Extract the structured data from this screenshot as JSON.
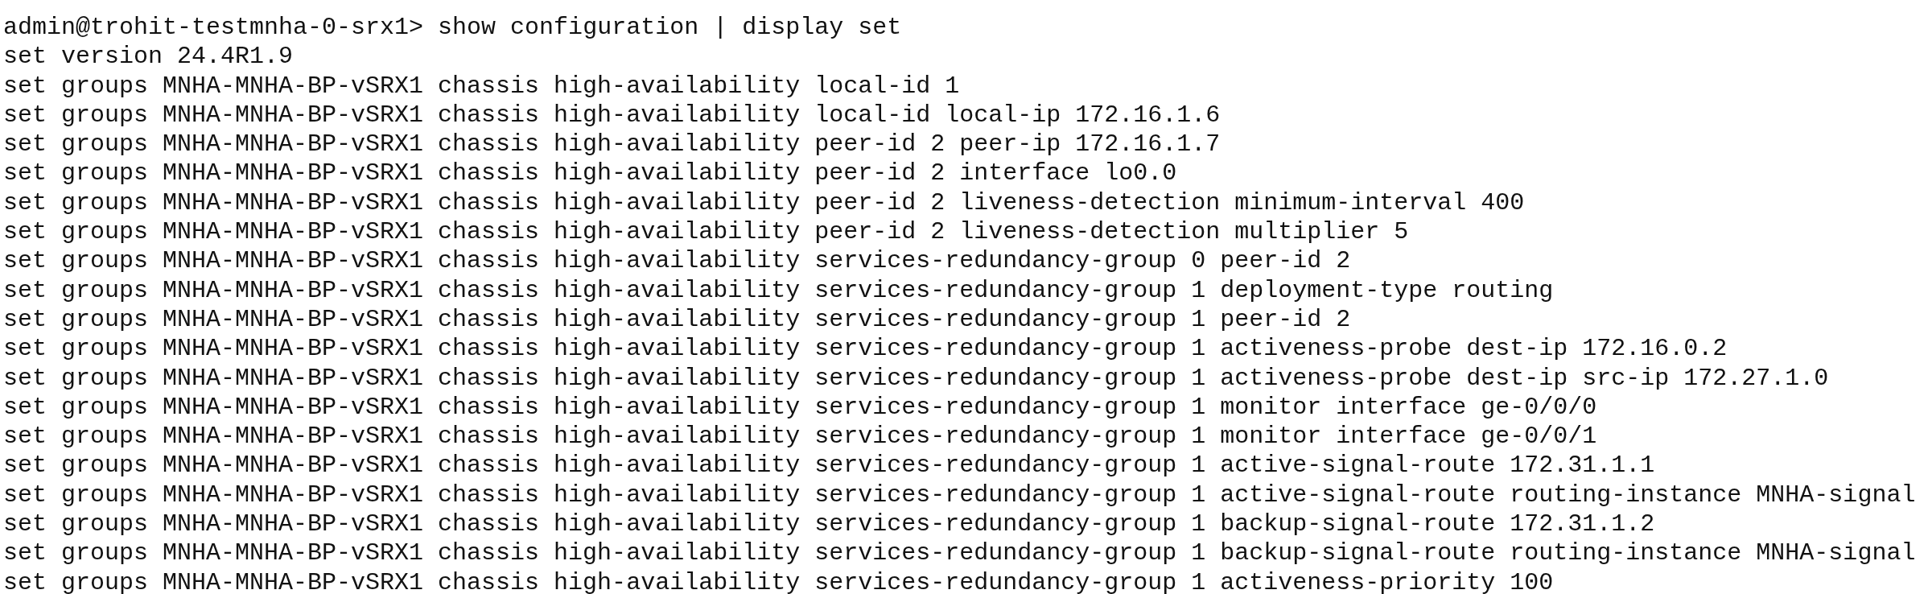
{
  "terminal": {
    "prompt": "admin@trohit-testmnha-0-srx1>",
    "command": "show configuration | display set",
    "lines": [
      "set version 24.4R1.9",
      "set groups MNHA-MNHA-BP-vSRX1 chassis high-availability local-id 1",
      "set groups MNHA-MNHA-BP-vSRX1 chassis high-availability local-id local-ip 172.16.1.6",
      "set groups MNHA-MNHA-BP-vSRX1 chassis high-availability peer-id 2 peer-ip 172.16.1.7",
      "set groups MNHA-MNHA-BP-vSRX1 chassis high-availability peer-id 2 interface lo0.0",
      "set groups MNHA-MNHA-BP-vSRX1 chassis high-availability peer-id 2 liveness-detection minimum-interval 400",
      "set groups MNHA-MNHA-BP-vSRX1 chassis high-availability peer-id 2 liveness-detection multiplier 5",
      "set groups MNHA-MNHA-BP-vSRX1 chassis high-availability services-redundancy-group 0 peer-id 2",
      "set groups MNHA-MNHA-BP-vSRX1 chassis high-availability services-redundancy-group 1 deployment-type routing",
      "set groups MNHA-MNHA-BP-vSRX1 chassis high-availability services-redundancy-group 1 peer-id 2",
      "set groups MNHA-MNHA-BP-vSRX1 chassis high-availability services-redundancy-group 1 activeness-probe dest-ip 172.16.0.2",
      "set groups MNHA-MNHA-BP-vSRX1 chassis high-availability services-redundancy-group 1 activeness-probe dest-ip src-ip 172.27.1.0",
      "set groups MNHA-MNHA-BP-vSRX1 chassis high-availability services-redundancy-group 1 monitor interface ge-0/0/0",
      "set groups MNHA-MNHA-BP-vSRX1 chassis high-availability services-redundancy-group 1 monitor interface ge-0/0/1",
      "set groups MNHA-MNHA-BP-vSRX1 chassis high-availability services-redundancy-group 1 active-signal-route 172.31.1.1",
      "set groups MNHA-MNHA-BP-vSRX1 chassis high-availability services-redundancy-group 1 active-signal-route routing-instance MNHA-signal",
      "set groups MNHA-MNHA-BP-vSRX1 chassis high-availability services-redundancy-group 1 backup-signal-route 172.31.1.2",
      "set groups MNHA-MNHA-BP-vSRX1 chassis high-availability services-redundancy-group 1 backup-signal-route routing-instance MNHA-signal",
      "set groups MNHA-MNHA-BP-vSRX1 chassis high-availability services-redundancy-group 1 activeness-priority 100"
    ]
  }
}
